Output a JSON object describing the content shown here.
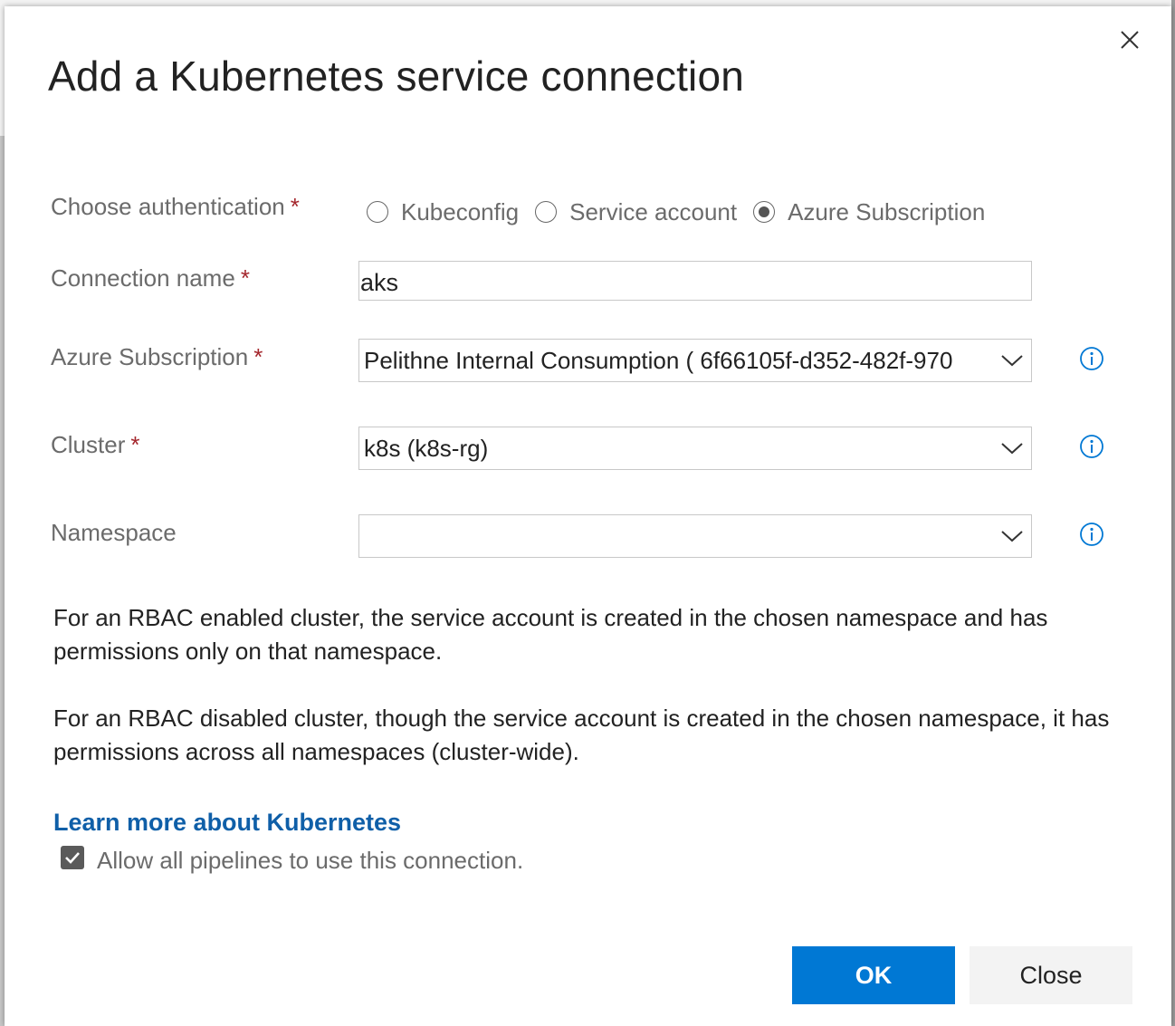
{
  "dialog": {
    "title": "Add a Kubernetes service connection",
    "close_icon": "close-icon"
  },
  "auth": {
    "label": "Choose authentication",
    "required_mark": "*",
    "options": [
      {
        "label": "Kubeconfig",
        "selected": false
      },
      {
        "label": "Service account",
        "selected": false
      },
      {
        "label": "Azure Subscription",
        "selected": true
      }
    ]
  },
  "connection_name": {
    "label": "Connection name",
    "required_mark": "*",
    "value": "aks"
  },
  "azure_subscription": {
    "label": "Azure Subscription",
    "required_mark": "*",
    "value": "Pelithne Internal Consumption ( 6f66105f-d352-482f-970",
    "info_icon": "info-icon"
  },
  "cluster": {
    "label": "Cluster",
    "required_mark": "*",
    "value": "k8s (k8s-rg)",
    "info_icon": "info-icon"
  },
  "namespace": {
    "label": "Namespace",
    "value": "",
    "info_icon": "info-icon"
  },
  "help": {
    "rbac_enabled": "For an RBAC enabled cluster, the service account is created in the chosen namespace and has permissions only on that namespace.",
    "rbac_disabled": "For an RBAC disabled cluster, though the service account is created in the chosen namespace, it has permissions across all namespaces (cluster-wide)."
  },
  "learn_more": "Learn more about Kubernetes",
  "allow_all": {
    "label": "Allow all pipelines to use this connection.",
    "checked": true
  },
  "buttons": {
    "ok": "OK",
    "close": "Close"
  },
  "colors": {
    "primary": "#0078d4",
    "link": "#0f5fa8",
    "required": "#a4262c",
    "info": "#0078d4"
  }
}
